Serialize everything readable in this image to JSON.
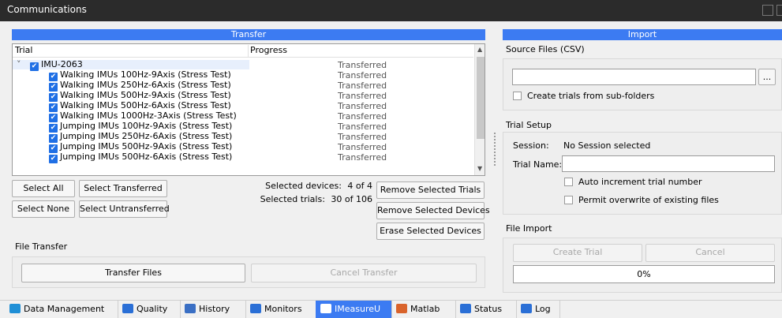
{
  "window": {
    "title": "Communications"
  },
  "transfer": {
    "header": "Transfer",
    "columns": {
      "trial": "Trial",
      "progress": "Progress"
    },
    "group": {
      "name": "IMU-2063",
      "status": "Transferred",
      "expand_glyph": "˅"
    },
    "rows": [
      {
        "name": "Walking IMUs 100Hz-9Axis (Stress Test)",
        "status": "Transferred"
      },
      {
        "name": "Walking IMUs 250Hz-6Axis (Stress Test)",
        "status": "Transferred"
      },
      {
        "name": "Walking IMUs 500Hz-9Axis (Stress Test)",
        "status": "Transferred"
      },
      {
        "name": "Walking IMUs 500Hz-6Axis (Stress Test)",
        "status": "Transferred"
      },
      {
        "name": "Walking IMUs 1000Hz-3Axis (Stress Test)",
        "status": "Transferred"
      },
      {
        "name": "Jumping IMUs 100Hz-9Axis (Stress Test)",
        "status": "Transferred"
      },
      {
        "name": "Jumping IMUs 250Hz-6Axis (Stress Test)",
        "status": "Transferred"
      },
      {
        "name": "Jumping IMUs 500Hz-9Axis (Stress Test)",
        "status": "Transferred"
      },
      {
        "name": "Jumping IMUs 500Hz-6Axis (Stress Test)",
        "status": "Transferred"
      }
    ],
    "buttons": {
      "select_all": "Select All",
      "select_transferred": "Select Transferred",
      "select_none": "Select None",
      "select_untransferred": "Select Untransferred",
      "remove_trials": "Remove Selected Trials",
      "remove_devices": "Remove Selected Devices",
      "erase_devices": "Erase Selected Devices"
    },
    "selected_devices_label": "Selected devices:",
    "selected_devices_value": "4 of 4",
    "selected_trials_label": "Selected trials:",
    "selected_trials_value": "30 of 106"
  },
  "file_transfer": {
    "title": "File Transfer",
    "transfer_button": "Transfer Files",
    "cancel_button": "Cancel Transfer"
  },
  "import": {
    "header": "Import",
    "source_title": "Source Files (CSV)",
    "source_value": "",
    "browse_label": "...",
    "subfolders_label": "Create trials from sub-folders",
    "trial_setup_title": "Trial Setup",
    "session_label": "Session:",
    "session_value": "No Session selected",
    "trial_name_label": "Trial Name:",
    "trial_name_value": "",
    "auto_increment_label": "Auto increment trial number",
    "permit_overwrite_label": "Permit overwrite of existing files",
    "file_import_title": "File Import",
    "create_trial_button": "Create Trial",
    "cancel_button": "Cancel",
    "progress_text": "0%",
    "progress": 0
  },
  "tabs": [
    {
      "label": "Data Management",
      "icon": "folder-icon",
      "color": "#1f8fd6"
    },
    {
      "label": "Quality",
      "icon": "q-icon",
      "color": "#2a6fd6"
    },
    {
      "label": "History",
      "icon": "history-icon",
      "color": "#3a6fc4"
    },
    {
      "label": "Monitors",
      "icon": "monitor-icon",
      "color": "#2a6fd6"
    },
    {
      "label": "IMeasureU",
      "icon": "imeasureu-icon",
      "color": "#ffffff"
    },
    {
      "label": "Matlab",
      "icon": "matlab-icon",
      "color": "#d9632b"
    },
    {
      "label": "Status",
      "icon": "plus-icon",
      "color": "#2a6fd6"
    },
    {
      "label": "Log",
      "icon": "log-icon",
      "color": "#2a6fd6"
    }
  ],
  "colors": {
    "accent": "#3c7bf2",
    "checkbox": "#1f6fe5"
  }
}
